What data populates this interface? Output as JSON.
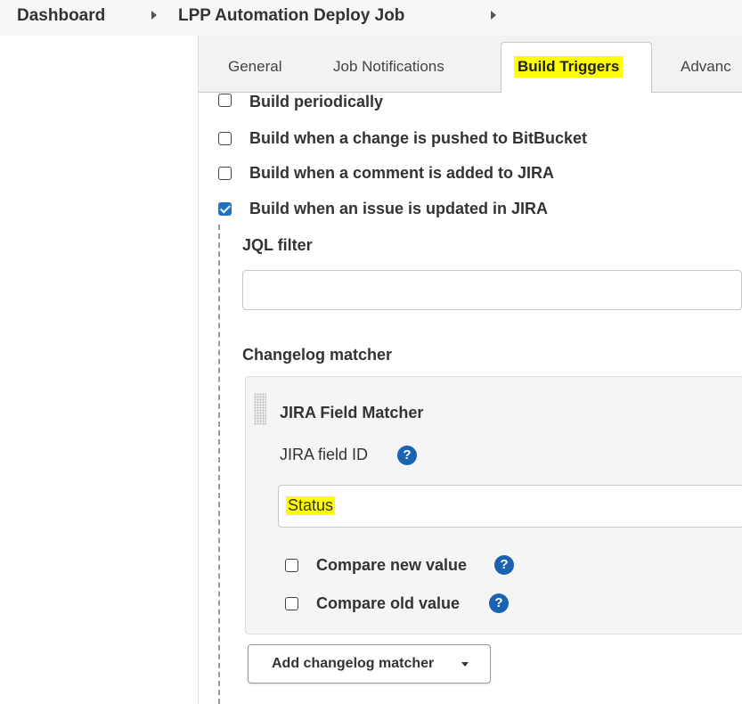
{
  "breadcrumb": {
    "items": [
      "Dashboard",
      "LPP Automation Deploy Job"
    ]
  },
  "tabs": {
    "items": [
      "General",
      "Job Notifications",
      "Build Triggers",
      "Advanc"
    ],
    "active": "Build Triggers",
    "highlight_color": "#ffff00"
  },
  "triggers": [
    {
      "label": "Build periodically",
      "checked": false
    },
    {
      "label": "Build when a change is pushed to BitBucket",
      "checked": false
    },
    {
      "label": "Build when a comment is added to JIRA",
      "checked": false
    },
    {
      "label": "Build when an issue is updated in JIRA",
      "checked": true
    }
  ],
  "jql_filter": {
    "label": "JQL filter",
    "value": ""
  },
  "changelog": {
    "label": "Changelog matcher",
    "matcher": {
      "title": "JIRA Field Matcher",
      "field_id_label": "JIRA field ID",
      "field_id_value": "Status",
      "compare_new": {
        "label": "Compare new value",
        "checked": false
      },
      "compare_old": {
        "label": "Compare old value",
        "checked": false
      }
    },
    "add_button": "Add changelog matcher"
  },
  "icons": {
    "help": "help-icon",
    "breadcrumb_separator": "chevron-right-icon",
    "dropdown": "caret-down-icon",
    "drag": "drag-handle-icon"
  },
  "colors": {
    "checkbox_checked": "#1a73c9",
    "help_icon": "#1a62b2"
  }
}
